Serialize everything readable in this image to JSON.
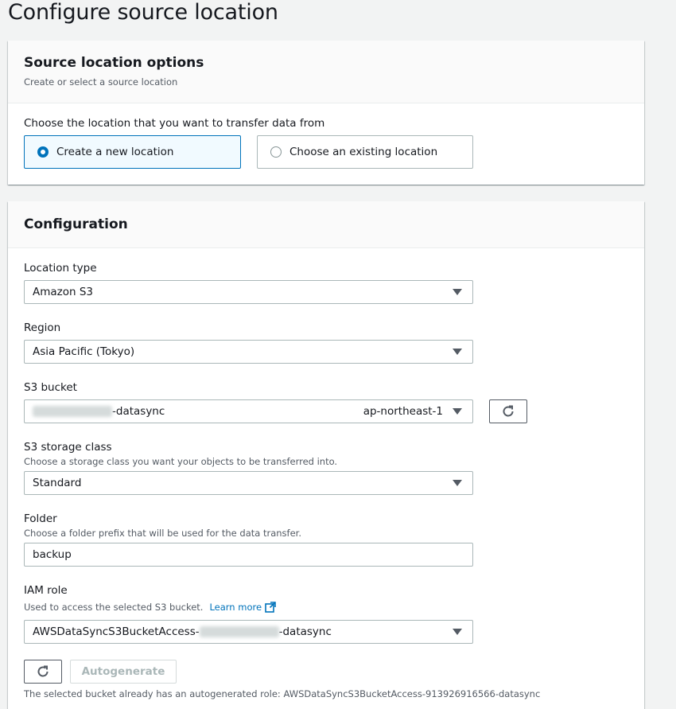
{
  "page": {
    "title": "Configure source location"
  },
  "source_panel": {
    "title": "Source location options",
    "description": "Create or select a source location",
    "question": "Choose the location that you want to transfer data from",
    "options": [
      {
        "label": "Create a new location",
        "selected": true
      },
      {
        "label": "Choose an existing location",
        "selected": false
      }
    ]
  },
  "config_panel": {
    "title": "Configuration",
    "location_type": {
      "label": "Location type",
      "value": "Amazon S3"
    },
    "region": {
      "label": "Region",
      "value": "Asia Pacific (Tokyo)"
    },
    "s3_bucket": {
      "label": "S3 bucket",
      "value_suffix": "-datasync",
      "region_tag": "ap-northeast-1"
    },
    "storage_class": {
      "label": "S3 storage class",
      "description": "Choose a storage class you want your objects to be transferred into.",
      "value": "Standard"
    },
    "folder": {
      "label": "Folder",
      "description": "Choose a folder prefix that will be used for the data transfer.",
      "value": "backup"
    },
    "iam_role": {
      "label": "IAM role",
      "description": "Used to access the selected S3 bucket.",
      "learn_more": "Learn more",
      "value_prefix": "AWSDataSyncS3BucketAccess-",
      "value_suffix": "-datasync",
      "autogenerate_label": "Autogenerate",
      "note": "The selected bucket already has an autogenerated role: AWSDataSyncS3BucketAccess-913926916566-datasync"
    }
  },
  "icons": {
    "refresh": "refresh-icon",
    "external": "external-link-icon",
    "caret": "caret-down-icon"
  },
  "colors": {
    "accent": "#0073bb",
    "background": "#f2f3f3",
    "selected_tile_bg": "#f1faff"
  }
}
